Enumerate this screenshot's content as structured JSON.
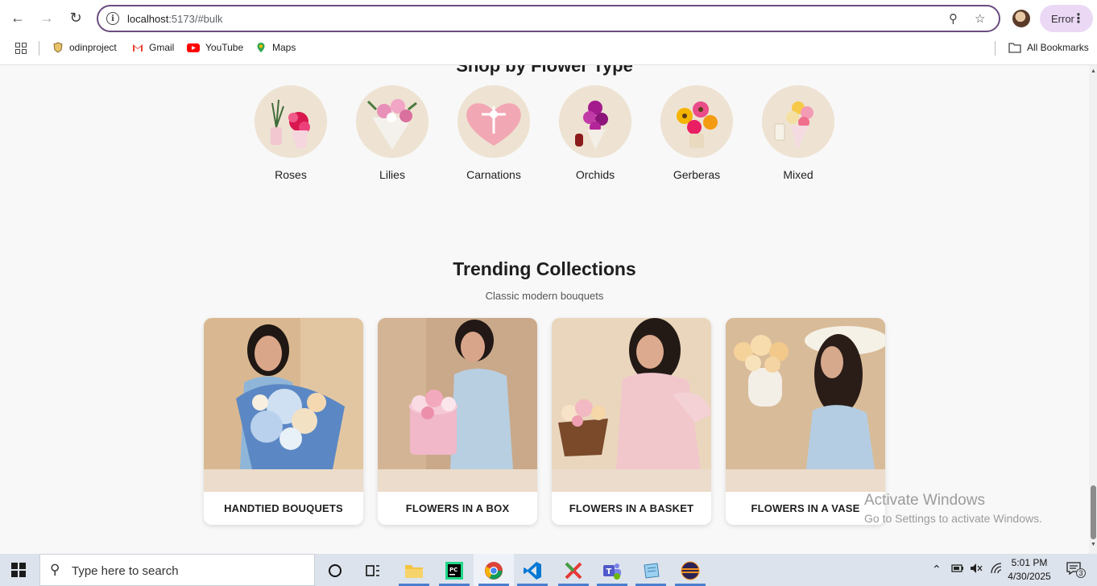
{
  "browser": {
    "url_host": "localhost",
    "url_rest": ":5173/#bulk",
    "profile_status": "Error",
    "bookmarks": [
      "odinproject",
      "Gmail",
      "YouTube",
      "Maps"
    ],
    "all_bookmarks": "All Bookmarks"
  },
  "page": {
    "flower_types_title": "Shop by Flower Type",
    "flower_types": [
      "Roses",
      "Lilies",
      "Carnations",
      "Orchids",
      "Gerberas",
      "Mixed"
    ],
    "trending_title": "Trending Collections",
    "trending_subtitle": "Classic modern bouquets",
    "collections": [
      "HANDTIED BOUQUETS",
      "FLOWERS IN A BOX",
      "FLOWERS IN A BASKET",
      "FLOWERS IN A VASE"
    ]
  },
  "watermark": {
    "line1": "Activate Windows",
    "line2": "Go to Settings to activate Windows."
  },
  "taskbar": {
    "search_placeholder": "Type here to search",
    "time": "5:01 PM",
    "date": "4/30/2025",
    "notification_count": "3"
  },
  "colors": {
    "omnibox_border": "#6b4c7f",
    "error_pill": "#ead8f5",
    "card_band": "#ecdccb",
    "page_bg": "#f8f8f8"
  }
}
